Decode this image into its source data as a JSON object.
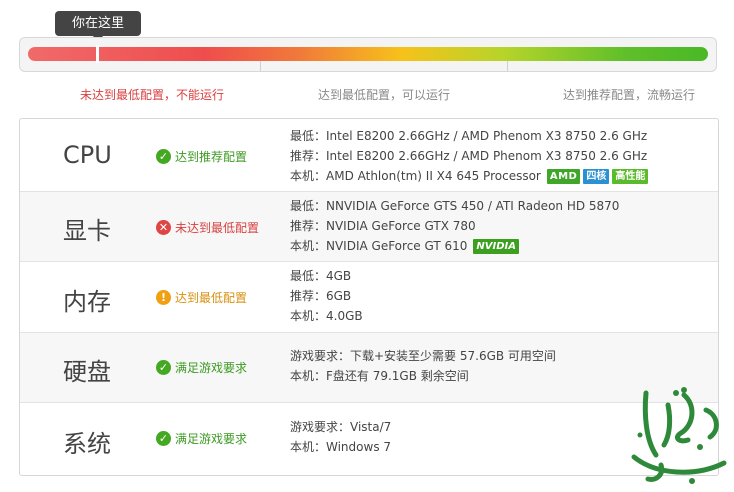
{
  "gauge": {
    "tooltip": "你在这里",
    "position_fraction": 0.11,
    "levels": {
      "below_min": "未达到最低配置，不能运行",
      "min": "达到最低配置，可以运行",
      "recommended": "达到推荐配置，流畅运行"
    }
  },
  "rows": [
    {
      "name": "CPU",
      "status": "达到推荐配置",
      "status_type": "ok",
      "lines": [
        "最低：Intel E8200 2.66GHz / AMD Phenom X3 8750 2.6 GHz",
        "推荐：Intel E8200 2.66GHz / AMD Phenom X3 8750 2.6 GHz",
        "本机：AMD Athlon(tm) II X4 645 Processor"
      ],
      "badges": [
        "AMD",
        "四核",
        "高性能"
      ]
    },
    {
      "name": "显卡",
      "status": "未达到最低配置",
      "status_type": "bad",
      "lines": [
        "最低：NNVIDIA GeForce GTS 450 / ATI Radeon HD 5870",
        "推荐：NVIDIA GeForce GTX 780",
        "本机：NVIDIA GeForce GT 610"
      ],
      "badges": [
        "NVIDIA"
      ]
    },
    {
      "name": "内存",
      "status": "达到最低配置",
      "status_type": "warn",
      "lines": [
        "最低：4GB",
        "推荐：6GB",
        "本机：4.0GB"
      ]
    },
    {
      "name": "硬盘",
      "status": "满足游戏要求",
      "status_type": "ok",
      "lines": [
        "游戏要求：下载+安装至少需要 57.6GB 可用空间",
        "本机：F盘还有 79.1GB 剩余空间"
      ]
    },
    {
      "name": "系统",
      "status": "满足游戏要求",
      "status_type": "ok",
      "lines": [
        "游戏要求：Vista/7",
        "本机：Windows 7"
      ]
    }
  ],
  "colors": {
    "ok": "#44a823",
    "bad": "#e04545",
    "warn": "#f0a010",
    "amd_badge": "#3fa62a",
    "core_badge": "#2b91d1",
    "nvidia_badge": "#3d9f1f"
  },
  "watermark": {
    "text": "تاليفون"
  }
}
